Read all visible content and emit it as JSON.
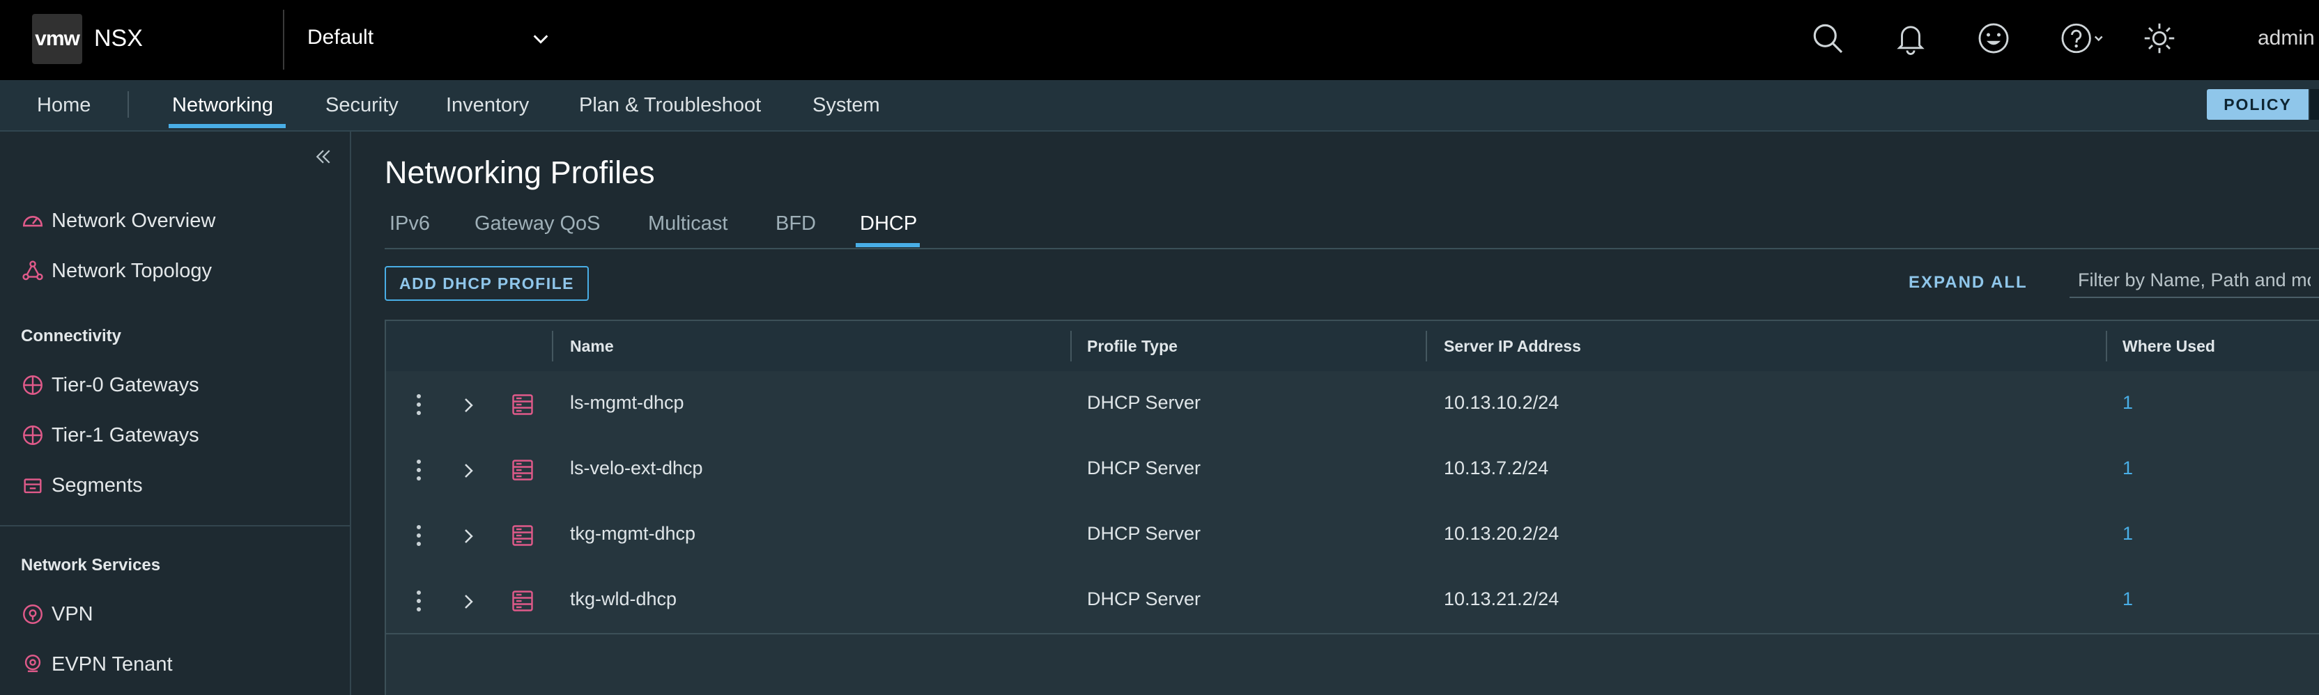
{
  "header": {
    "logo_text": "vmw",
    "app_name": "NSX",
    "project": "Default",
    "user": "admin"
  },
  "nav": {
    "items": [
      "Home",
      "Networking",
      "Security",
      "Inventory",
      "Plan & Troubleshoot",
      "System"
    ],
    "active": "Networking",
    "mode_button": "POLICY"
  },
  "sidebar": {
    "top_items": [
      "Network Overview",
      "Network Topology"
    ],
    "sections": [
      {
        "title": "Connectivity",
        "items": [
          "Tier-0 Gateways",
          "Tier-1 Gateways",
          "Segments"
        ]
      },
      {
        "title": "Network Services",
        "items": [
          "VPN",
          "EVPN Tenant"
        ]
      }
    ]
  },
  "main": {
    "title": "Networking Profiles",
    "tabs": [
      "IPv6",
      "Gateway QoS",
      "Multicast",
      "BFD",
      "DHCP"
    ],
    "active_tab": "DHCP",
    "add_button": "ADD DHCP PROFILE",
    "expand_all": "EXPAND ALL",
    "filter_placeholder": "Filter by Name, Path and more"
  },
  "table": {
    "columns": [
      "Name",
      "Profile Type",
      "Server IP Address",
      "Where Used"
    ],
    "rows": [
      {
        "name": "ls-mgmt-dhcp",
        "type": "DHCP Server",
        "ip": "10.13.10.2/24",
        "used": "1"
      },
      {
        "name": "ls-velo-ext-dhcp",
        "type": "DHCP Server",
        "ip": "10.13.7.2/24",
        "used": "1"
      },
      {
        "name": "tkg-mgmt-dhcp",
        "type": "DHCP Server",
        "ip": "10.13.20.2/24",
        "used": "1"
      },
      {
        "name": "tkg-wld-dhcp",
        "type": "DHCP Server",
        "ip": "10.13.21.2/24",
        "used": "1"
      }
    ]
  },
  "colors": {
    "accent": "#49aee6",
    "icon_pink": "#e05a8a",
    "header_bg": "#000000",
    "nav_bg": "#22333c",
    "content_bg": "#1e2a31"
  }
}
